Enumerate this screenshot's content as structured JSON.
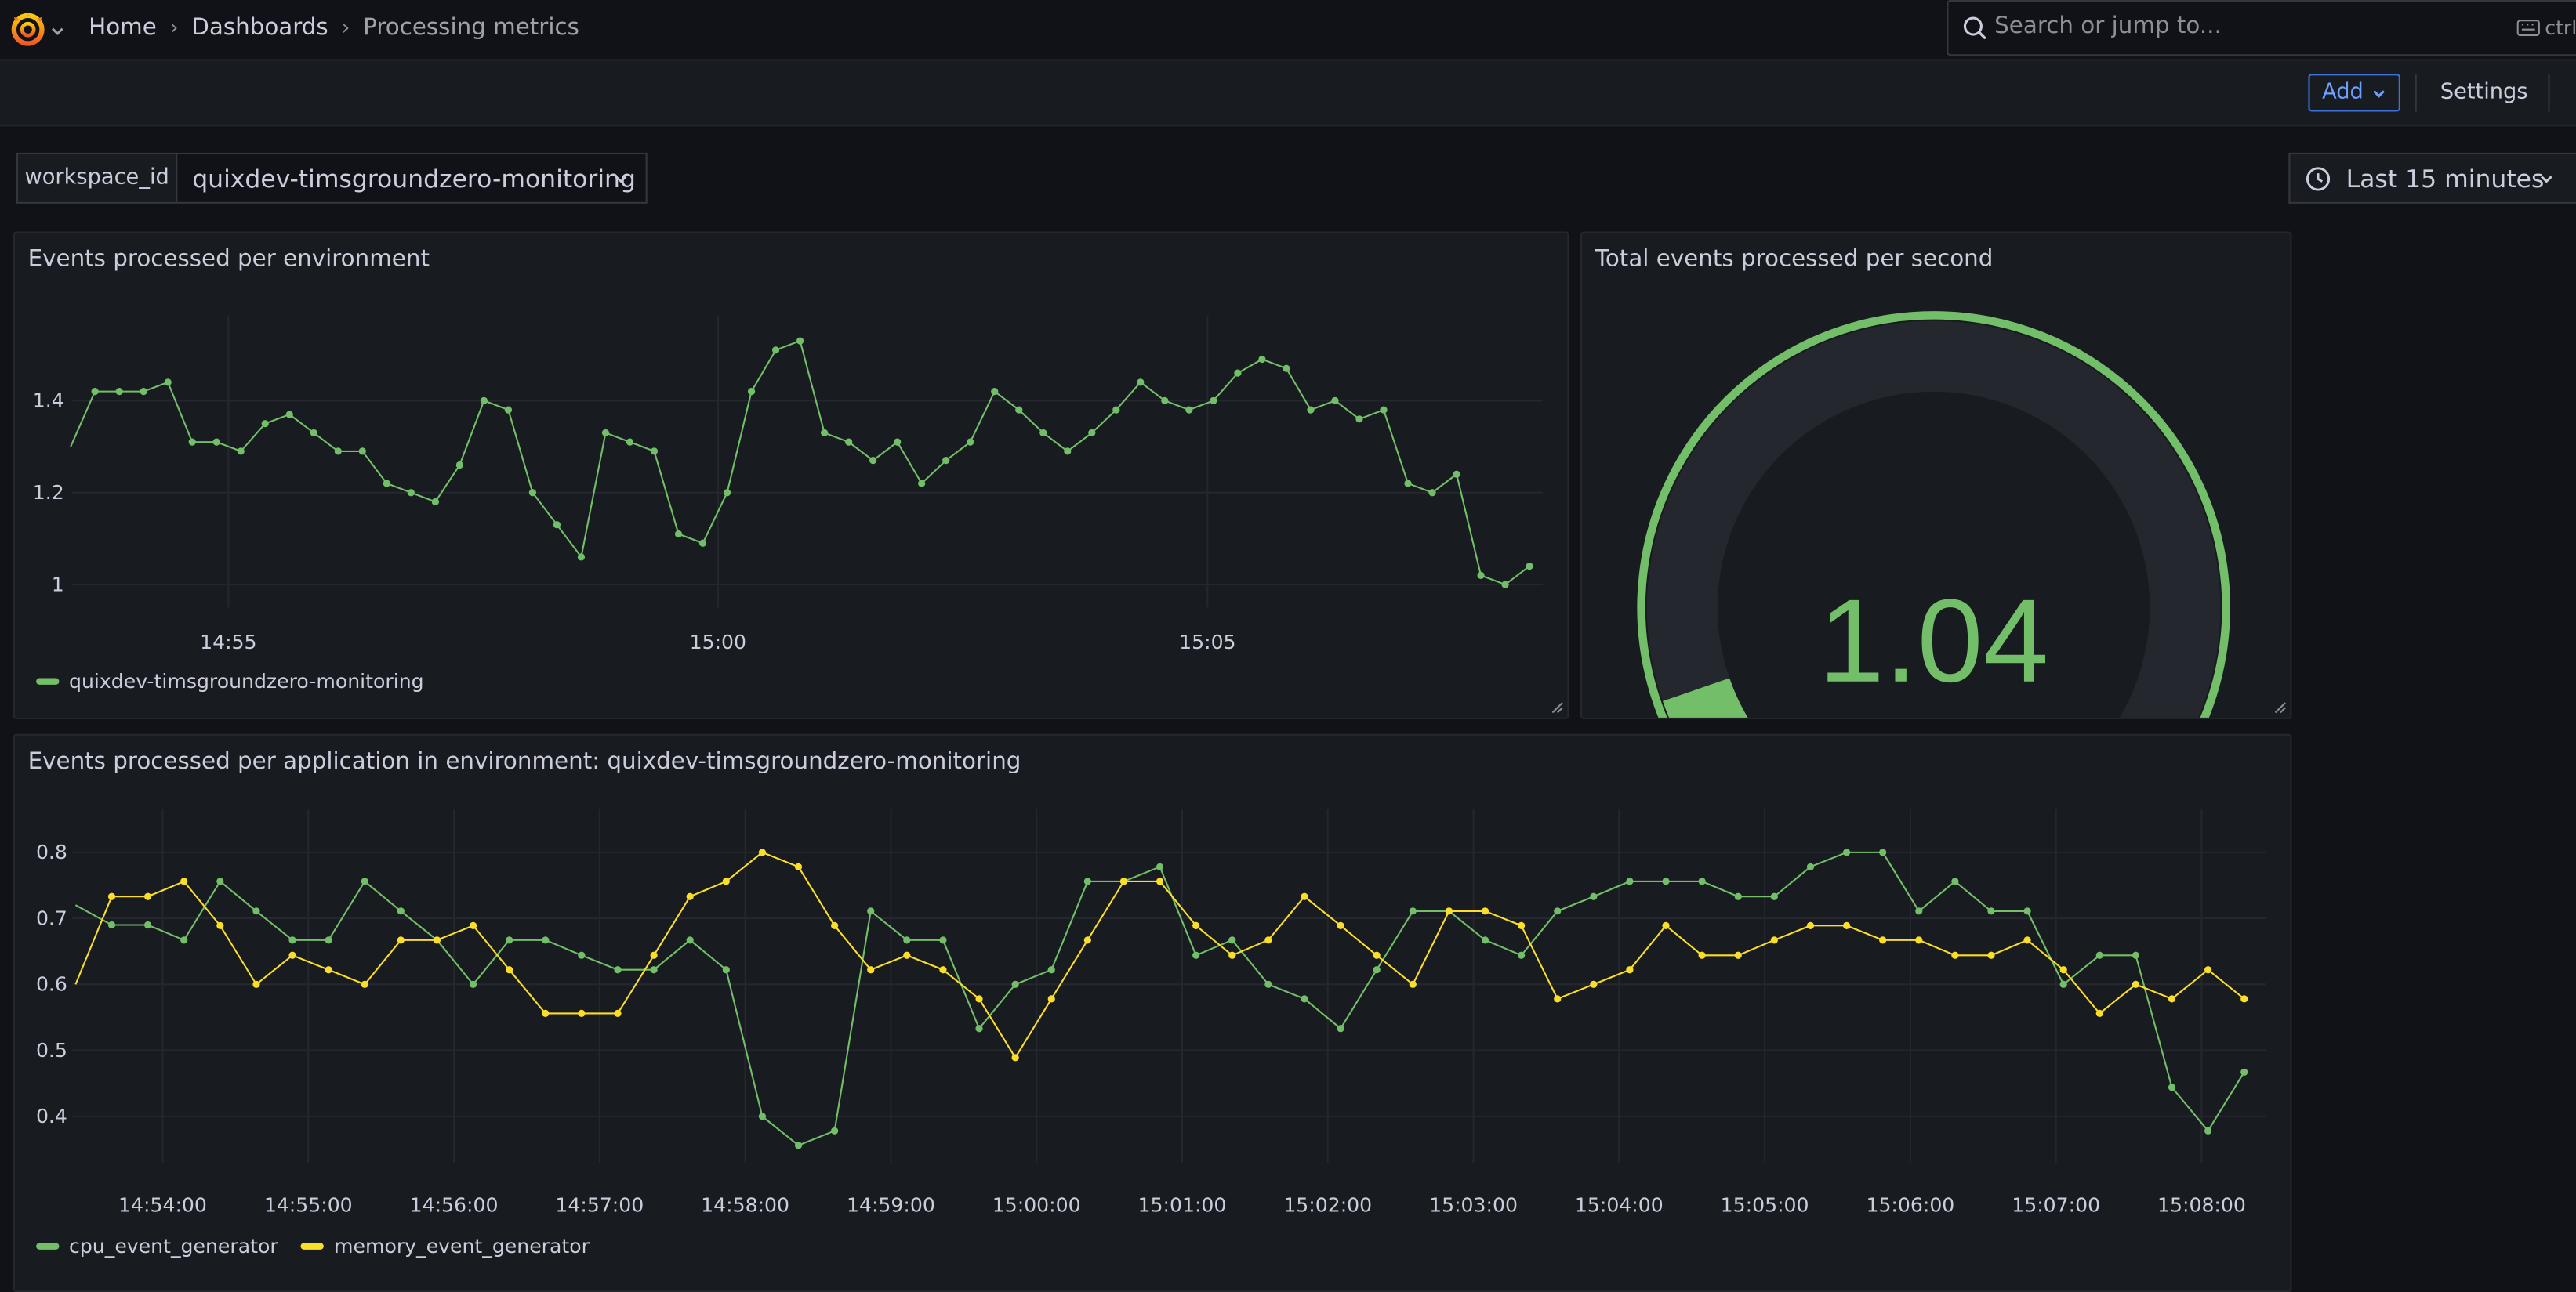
{
  "breadcrumbs": [
    {
      "label": "Home"
    },
    {
      "label": "Dashboards"
    },
    {
      "label": "Processing metrics"
    }
  ],
  "search": {
    "placeholder": "Search or jump to...",
    "shortcut": "ctrl"
  },
  "toolbar": {
    "add_label": "Add",
    "settings_label": "Settings"
  },
  "variable": {
    "label": "workspace_id",
    "value": "quixdev-timsgroundzero-monitoring"
  },
  "time_picker": {
    "label": "Last 15 minutes"
  },
  "colors": {
    "green": "#73bf69",
    "yellow": "#fade2a",
    "accent_blue": "#6e9fff",
    "gauge_track": "#25272e"
  },
  "panels": {
    "env": {
      "title": "Events processed per environment",
      "chart_data": {
        "type": "line",
        "x_ticks": [
          "14:55",
          "15:00",
          "15:05"
        ],
        "y_ticks": [
          "1",
          "1.2",
          "1.4"
        ],
        "ylim": [
          0.95,
          1.55
        ],
        "series": [
          {
            "name": "quixdev-timsgroundzero-monitoring",
            "color": "#73bf69",
            "values": [
              1.3,
              1.42,
              1.42,
              1.42,
              1.44,
              1.31,
              1.31,
              1.29,
              1.35,
              1.37,
              1.33,
              1.29,
              1.29,
              1.22,
              1.2,
              1.18,
              1.26,
              1.4,
              1.38,
              1.2,
              1.13,
              1.06,
              1.33,
              1.31,
              1.29,
              1.11,
              1.09,
              1.2,
              1.42,
              1.51,
              1.53,
              1.33,
              1.31,
              1.27,
              1.31,
              1.22,
              1.27,
              1.31,
              1.42,
              1.38,
              1.33,
              1.29,
              1.33,
              1.38,
              1.44,
              1.4,
              1.38,
              1.4,
              1.46,
              1.49,
              1.47,
              1.38,
              1.4,
              1.36,
              1.38,
              1.22,
              1.2,
              1.24,
              1.02,
              1.0,
              1.04
            ]
          }
        ],
        "legend": "bottom-left",
        "grid": true
      }
    },
    "gauge": {
      "title": "Total events processed per second",
      "value": "1.04",
      "value_num": 1.04,
      "min": 0,
      "max": 1.53,
      "color": "#73bf69"
    },
    "apps": {
      "title": "Events processed per application in environment: quixdev-timsgroundzero-monitoring",
      "chart_data": {
        "type": "line",
        "x_ticks": [
          "14:54:00",
          "14:55:00",
          "14:56:00",
          "14:57:00",
          "14:58:00",
          "14:59:00",
          "15:00:00",
          "15:01:00",
          "15:02:00",
          "15:03:00",
          "15:04:00",
          "15:05:00",
          "15:06:00",
          "15:07:00",
          "15:08:00"
        ],
        "y_ticks": [
          "0.4",
          "0.5",
          "0.6",
          "0.7",
          "0.8"
        ],
        "ylim": [
          0.33,
          0.84
        ],
        "series": [
          {
            "name": "cpu_event_generator",
            "color": "#73bf69",
            "values": [
              0.72,
              0.69,
              0.69,
              0.667,
              0.756,
              0.711,
              0.667,
              0.667,
              0.756,
              0.711,
              0.667,
              0.6,
              0.667,
              0.667,
              0.644,
              0.622,
              0.622,
              0.667,
              0.622,
              0.4,
              0.356,
              0.378,
              0.711,
              0.667,
              0.667,
              0.533,
              0.6,
              0.622,
              0.756,
              0.756,
              0.778,
              0.644,
              0.667,
              0.6,
              0.578,
              0.533,
              0.622,
              0.711,
              0.711,
              0.667,
              0.644,
              0.711,
              0.733,
              0.756,
              0.756,
              0.756,
              0.733,
              0.733,
              0.778,
              0.8,
              0.8,
              0.711,
              0.756,
              0.711,
              0.711,
              0.6,
              0.644,
              0.644,
              0.444,
              0.378,
              0.467
            ]
          },
          {
            "name": "memory_event_generator",
            "color": "#fade2a",
            "values": [
              0.6,
              0.733,
              0.733,
              0.756,
              0.689,
              0.6,
              0.644,
              0.622,
              0.6,
              0.667,
              0.667,
              0.689,
              0.622,
              0.556,
              0.556,
              0.556,
              0.644,
              0.733,
              0.756,
              0.8,
              0.778,
              0.689,
              0.622,
              0.644,
              0.622,
              0.578,
              0.489,
              0.578,
              0.667,
              0.756,
              0.756,
              0.689,
              0.644,
              0.667,
              0.733,
              0.689,
              0.644,
              0.6,
              0.711,
              0.711,
              0.689,
              0.578,
              0.6,
              0.622,
              0.689,
              0.644,
              0.644,
              0.667,
              0.689,
              0.689,
              0.667,
              0.667,
              0.644,
              0.644,
              0.667,
              0.622,
              0.556,
              0.6,
              0.578,
              0.622,
              0.578
            ]
          }
        ],
        "legend": "bottom-left",
        "grid": true
      }
    }
  }
}
